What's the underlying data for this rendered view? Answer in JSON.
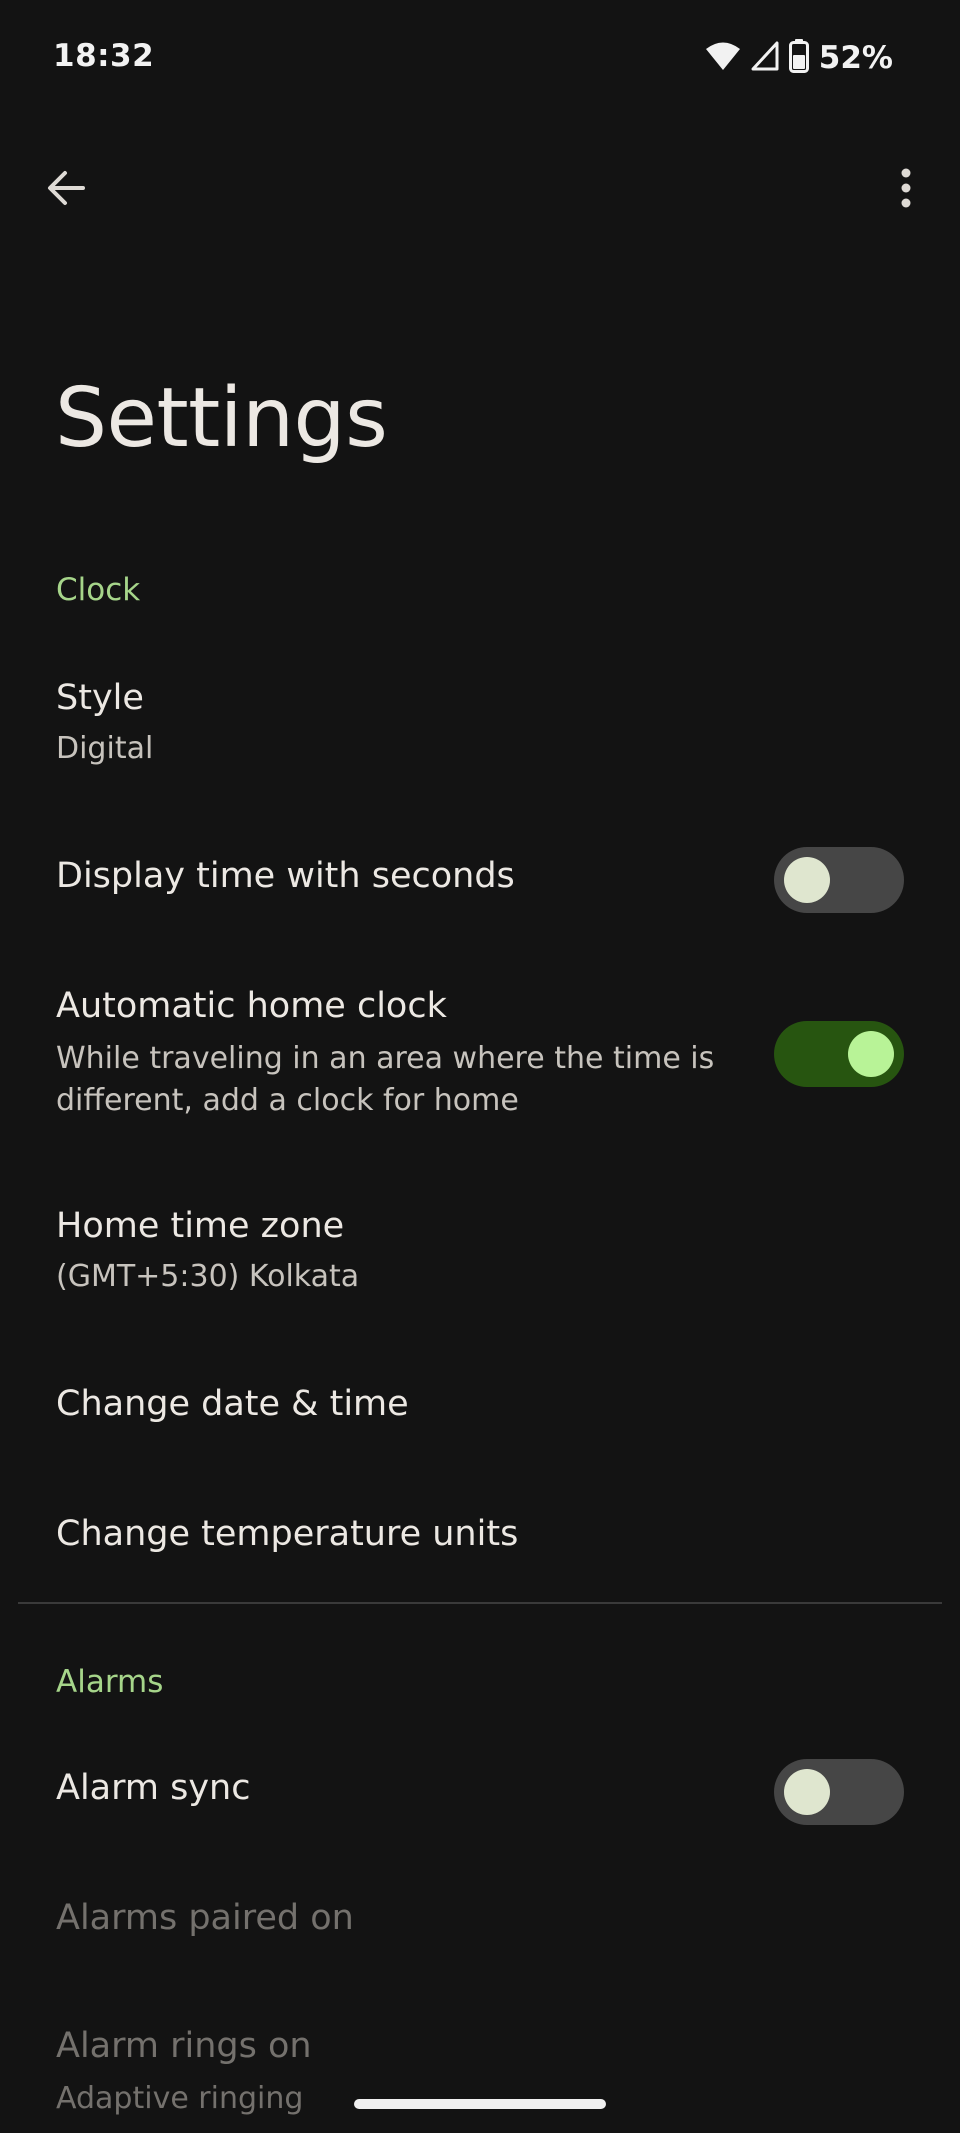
{
  "status_bar": {
    "time": "18:32",
    "battery_percent": "52%",
    "wifi_icon": "wifi-icon",
    "signal_icon": "cell-signal-icon",
    "battery_icon": "battery-icon"
  },
  "top_bar": {
    "back_icon": "arrow-left-icon",
    "more_icon": "more-vertical-icon"
  },
  "page": {
    "title": "Settings"
  },
  "clock_section": {
    "header": "Clock",
    "style": {
      "title": "Style",
      "summary": "Digital"
    },
    "display_seconds": {
      "title": "Display time with seconds",
      "enabled": false
    },
    "auto_home_clock": {
      "title": "Automatic home clock",
      "summary_line1": "While traveling in an area where the time is",
      "summary_line2": "different, add a clock for home",
      "enabled": true
    },
    "home_time_zone": {
      "title": "Home time zone",
      "summary": "(GMT+5:30) Kolkata"
    },
    "change_date_time": {
      "title": "Change date & time"
    },
    "change_temperature_units": {
      "title": "Change temperature units"
    }
  },
  "alarms_section": {
    "header": "Alarms",
    "alarm_sync": {
      "title": "Alarm sync",
      "enabled": false
    },
    "alarms_paired_on": {
      "title": "Alarms paired on"
    },
    "alarm_rings_on": {
      "title": "Alarm rings on",
      "summary": "Adaptive ringing"
    }
  },
  "colors": {
    "background": "#131313",
    "accent_green": "#a6d58a",
    "switch_on_track": "#275510",
    "switch_on_thumb": "#b8f397",
    "switch_off_track": "#464646",
    "switch_off_thumb": "#dfe6cf"
  }
}
